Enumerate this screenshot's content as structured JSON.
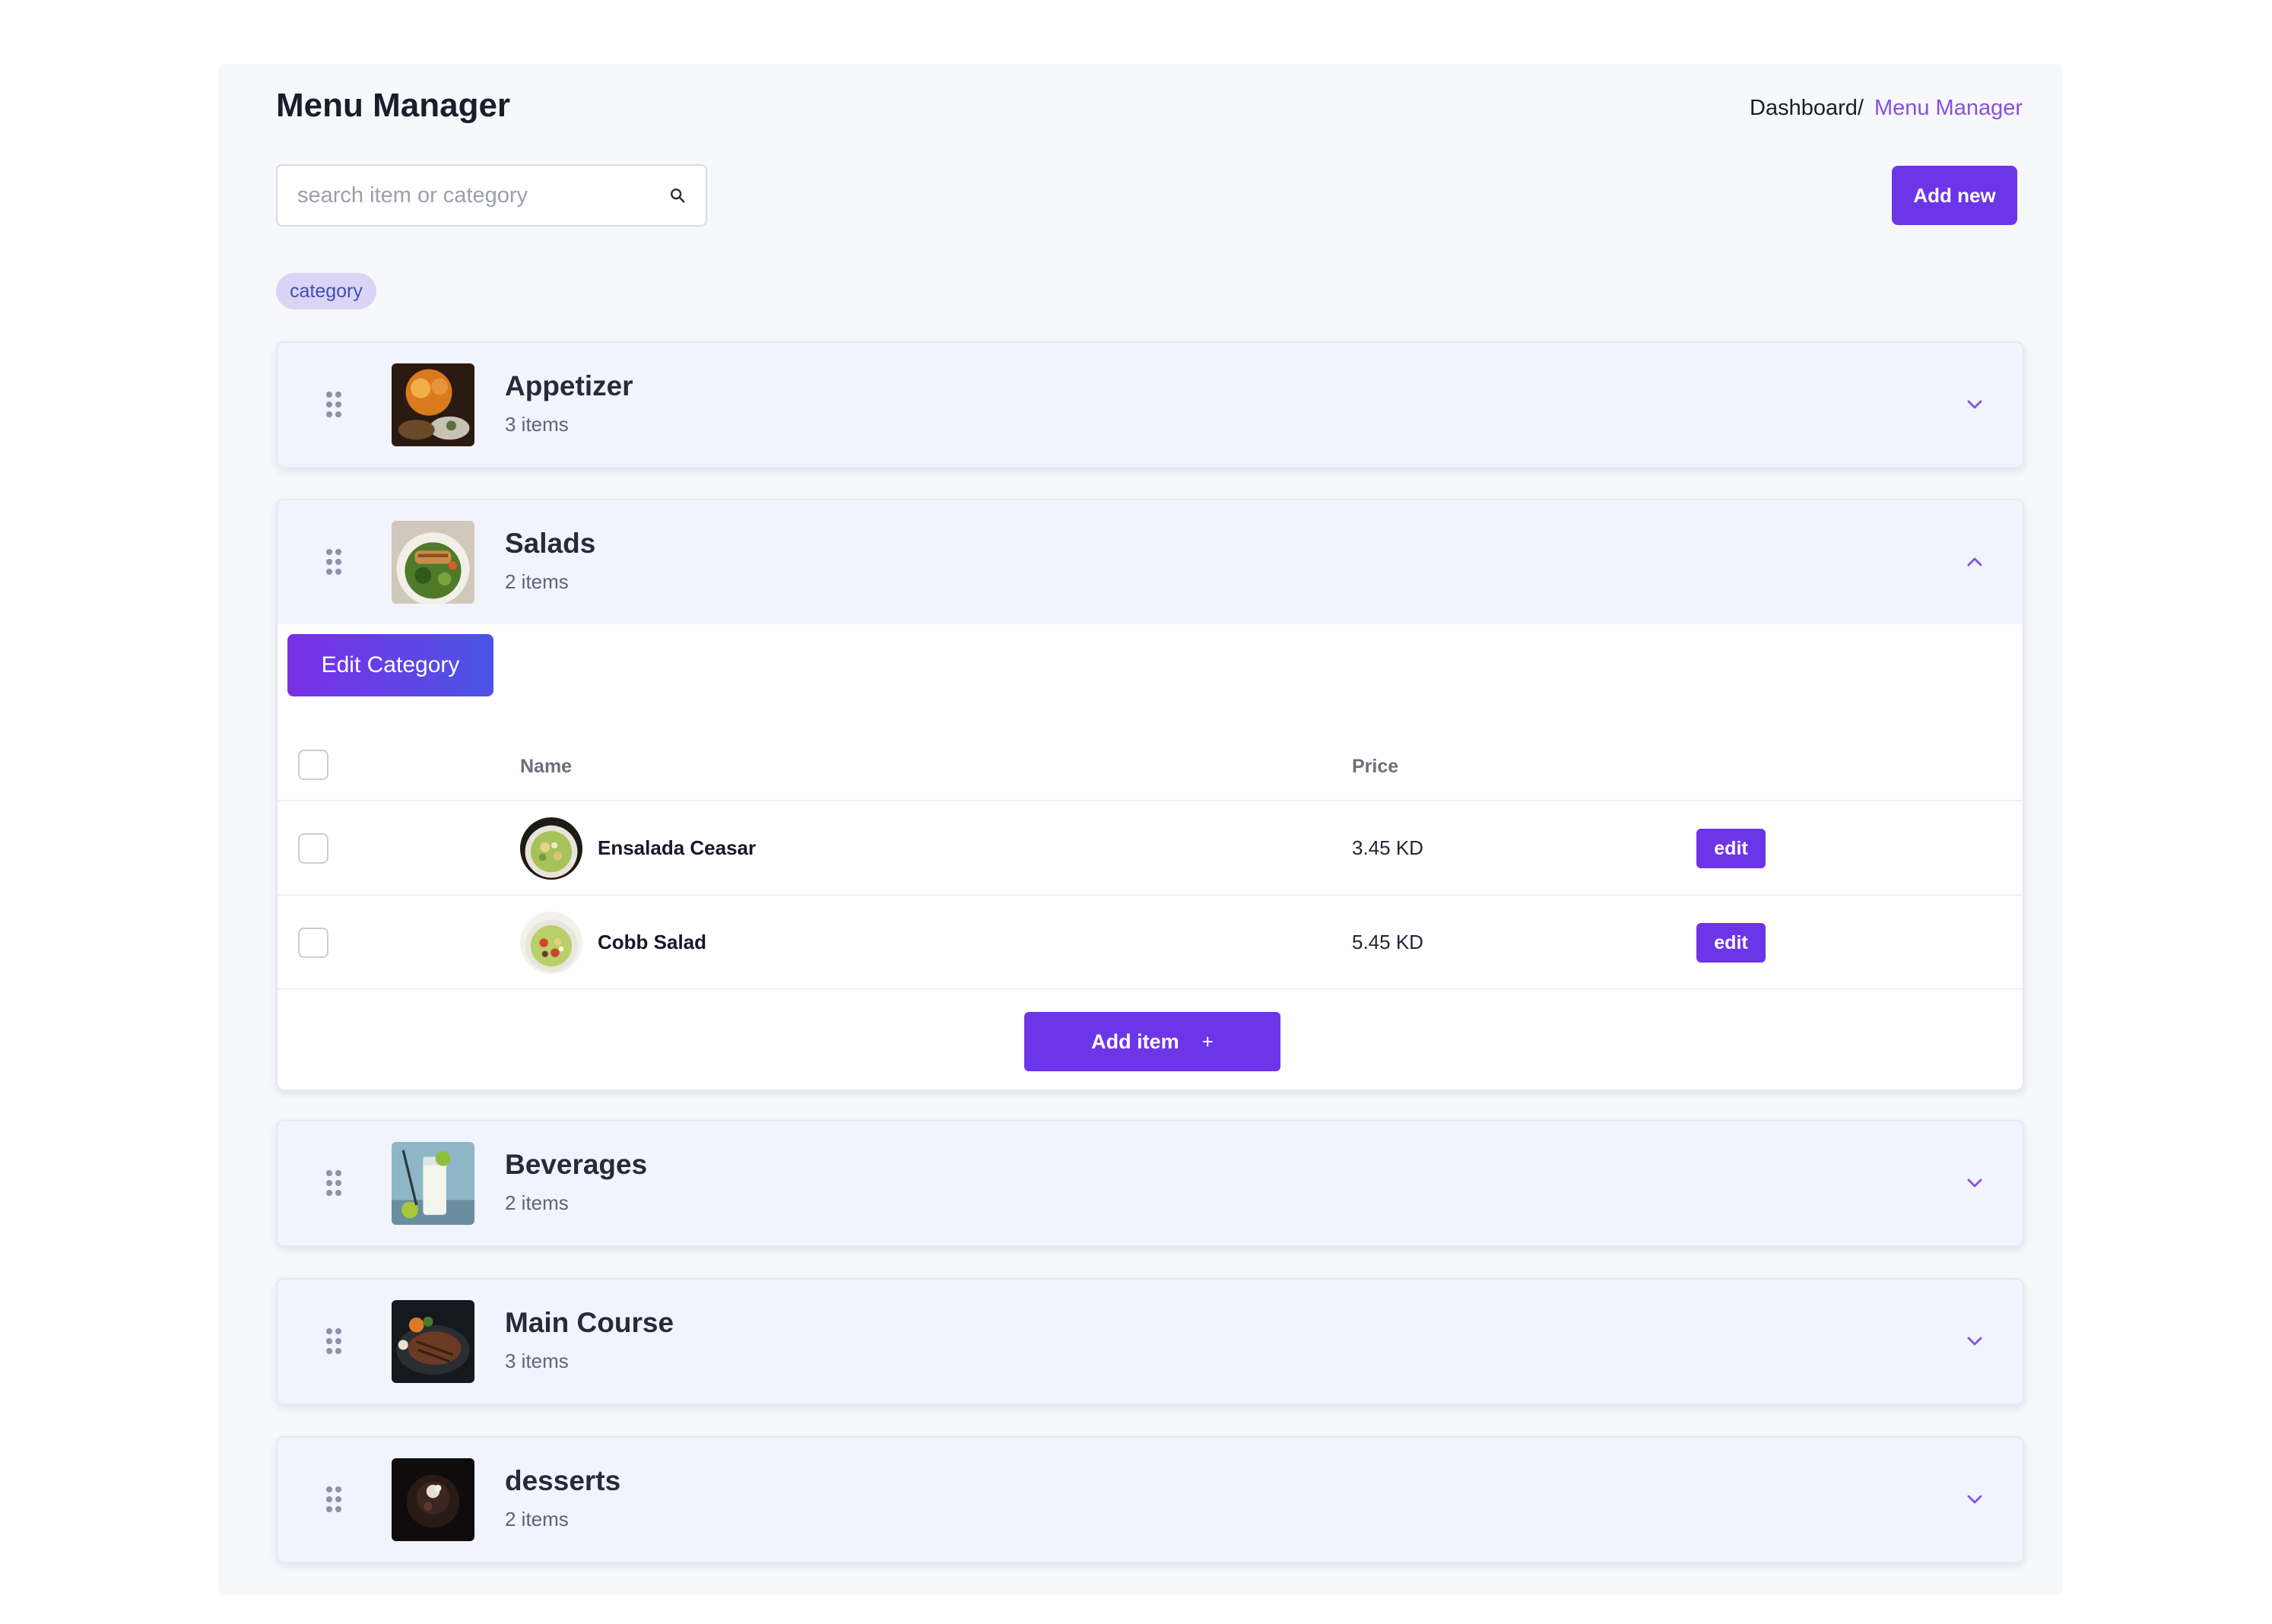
{
  "header": {
    "title": "Menu Manager",
    "breadcrumb_home": "Dashboard/",
    "breadcrumb_current": "Menu Manager"
  },
  "search": {
    "placeholder": "search item or category",
    "value": ""
  },
  "toolbar": {
    "add_new_label": "Add new"
  },
  "filter_chip": "category",
  "categories": [
    {
      "name": "Appetizer",
      "count": "3 items",
      "expanded": false,
      "thumb": "appetizer-photo"
    },
    {
      "name": "Salads",
      "count": "2 items",
      "expanded": true,
      "thumb": "salad-photo",
      "edit_label": "Edit Category",
      "columns": {
        "name": "Name",
        "price": "Price"
      },
      "items": [
        {
          "name": "Ensalada Ceasar",
          "price": "3.45 KD",
          "action": "edit"
        },
        {
          "name": "Cobb Salad",
          "price": "5.45 KD",
          "action": "edit"
        }
      ],
      "add_item_label": "Add item",
      "add_item_icon": "+"
    },
    {
      "name": "Beverages",
      "count": "2 items",
      "expanded": false,
      "thumb": "beverage-photo"
    },
    {
      "name": "Main Course",
      "count": "3 items",
      "expanded": false,
      "thumb": "steak-photo"
    },
    {
      "name": "desserts",
      "count": "2 items",
      "expanded": false,
      "thumb": "dessert-photo"
    }
  ],
  "colors": {
    "accent": "#6d35e8",
    "breadcrumb_active": "#8a4fe0",
    "card_background": "#f1f3fd",
    "chip_background": "#dcd4f7"
  }
}
